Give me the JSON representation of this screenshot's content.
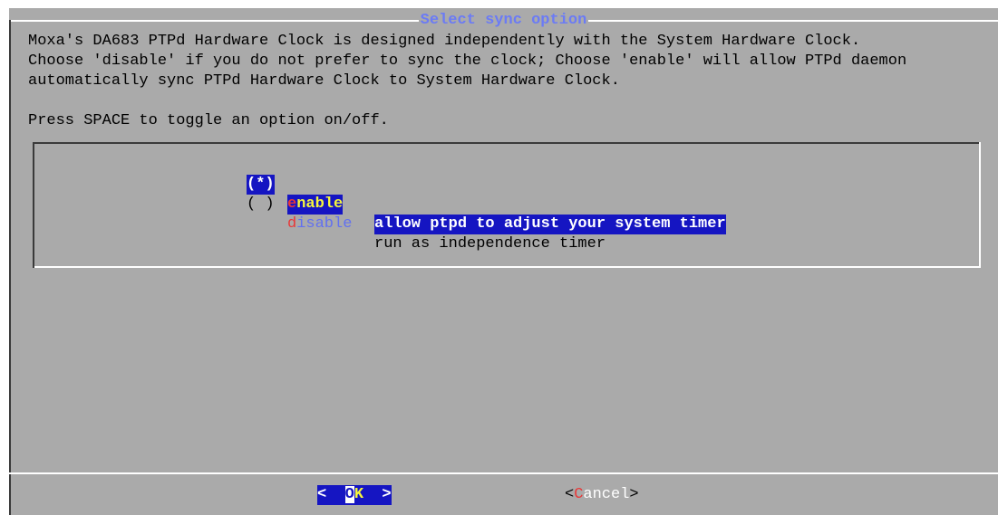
{
  "dialog": {
    "title": "Select sync option",
    "message_lines": [
      "Moxa's DA683 PTPd Hardware Clock is designed independently with the System Hardware Clock.",
      "Choose 'disable' if you do not prefer to sync the clock; Choose 'enable' will allow PTPd daemon",
      "automatically sync PTPd Hardware Clock to System Hardware Clock.",
      "",
      "Press SPACE to toggle an option on/off."
    ],
    "options": [
      {
        "mark": "(*)",
        "tag_hotkey": "e",
        "tag_rest": "nable",
        "description": "allow ptpd to adjust your system timer",
        "selected": true
      },
      {
        "mark": "( )",
        "tag_hotkey": "d",
        "tag_rest": "isable",
        "description": "run as independence timer",
        "selected": false
      }
    ],
    "buttons": {
      "ok": {
        "left": "<",
        "hotkey": "O",
        "rest": "K",
        "right": ">",
        "focused": true
      },
      "cancel": {
        "left": "<",
        "hotkey": "C",
        "rest": "ancel",
        "right": ">",
        "focused": false
      }
    }
  },
  "colors": {
    "terminal_background": "#ffffff",
    "dialog_background": "#aaaaaa",
    "title_text": "#6b7bf5",
    "selection_background": "#1515c2",
    "selected_tag_text": "#f6f63c",
    "hotkey_text": "#e83838",
    "unselected_tag_text": "#6170f0"
  }
}
